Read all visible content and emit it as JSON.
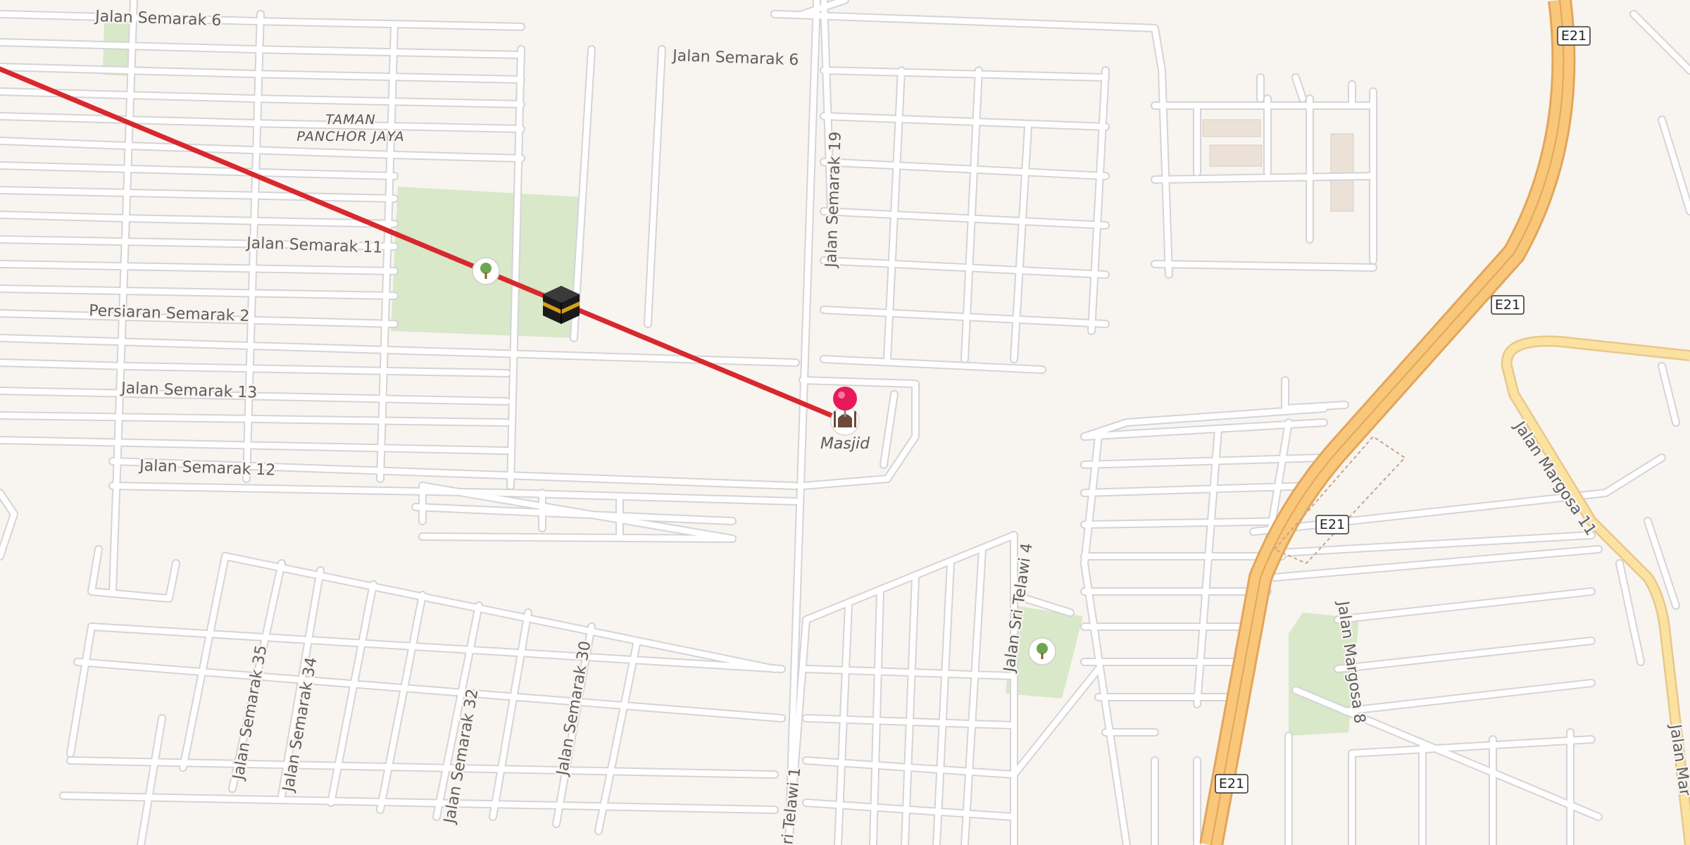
{
  "map": {
    "colors": {
      "background": "#f8f4f0",
      "park": "#d8e8c8",
      "motorway": "#f9c77a",
      "motorway_casing": "#e3a55a",
      "primary_road": "#fbe2a0",
      "qibla_line": "#d8282e"
    },
    "streets": {
      "semarak6_a": "Jalan Semarak 6",
      "semarak6_b": "Jalan Semarak 6",
      "semarak11": "Jalan Semarak 11",
      "persiaran2": "Persiaran Semarak 2",
      "semarak13": "Jalan Semarak 13",
      "semarak12": "Jalan Semarak 12",
      "semarak19": "Jalan Semarak 19",
      "semarak35": "Jalan Semarak 35",
      "semarak34": "Jalan Semarak 34",
      "semarak32": "Jalan Semarak 32",
      "semarak30": "Jalan Semarak 30",
      "telawi4": "Jalan Sri Telawi 4",
      "telawi1": "ri Telawi 1",
      "margosa11": "Jalan Margosa 11",
      "margosa8": "Jalan Margosa 8",
      "margosa_edge": "Jalan Mar"
    },
    "area": {
      "line1": "TAMAN",
      "line2": "PANCHOR JAYA"
    },
    "highway": {
      "ref": "E21"
    },
    "poi": {
      "mosque_label": "Masjid",
      "mosque_icon": "mosque-icon",
      "pin_icon": "map-pin-icon",
      "kaaba_icon": "kaaba-icon",
      "park_icon": "tree-icon"
    }
  }
}
